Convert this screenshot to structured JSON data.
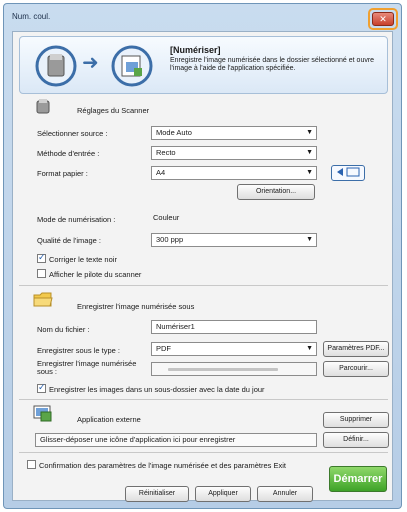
{
  "window": {
    "title": "Num. coul.",
    "close_glyph": "✕"
  },
  "banner": {
    "title": "[Numériser]",
    "description": "Enregistre l'image numérisée dans le dossier sélectionné et ouvre l'image à l'aide de l'application spécifiée.",
    "arrow": "➜"
  },
  "scanner": {
    "header": "Réglages du Scanner",
    "source_label": "Sélectionner source :",
    "source_value": "Mode Auto",
    "method_label": "Méthode d'entrée :",
    "method_value": "Recto",
    "format_label": "Format papier :",
    "format_value": "A4",
    "orientation_button": "Orientation...",
    "mode_label": "Mode de numérisation :",
    "mode_value": "Couleur",
    "quality_label": "Qualité de l'image :",
    "quality_value": "300 ppp",
    "correct_text_label": "Corriger le texte noir",
    "show_driver_label": "Afficher le pilote du scanner"
  },
  "save": {
    "header": "Enregistrer l'image numérisée sous",
    "filename_label": "Nom du fichier :",
    "filename_value": "Numériser1",
    "type_label": "Enregistrer sous le type :",
    "type_value": "PDF",
    "pdf_params_button": "Paramètres PDF...",
    "path_label": "Enregistrer l'image numérisée sous :",
    "browse_button": "Parcourir...",
    "subfolder_label": "Enregistrer les images dans un sous-dossier avec la date du jour"
  },
  "external": {
    "header": "Application externe",
    "drop_hint": "Glisser-déposer une icône d'application ici pour enregistrer",
    "delete_button": "Supprimer",
    "define_button": "Définir..."
  },
  "footer": {
    "confirm_label": "Confirmation des paramètres de l'image numérisée et des paramètres Exit",
    "reset_button": "Réinitialiser",
    "apply_button": "Appliquer",
    "cancel_button": "Annuler",
    "start_button": "Démarrer"
  },
  "colors": {
    "accent": "#2a62b0",
    "start": "#3ea328",
    "highlight": "#f0a030"
  }
}
